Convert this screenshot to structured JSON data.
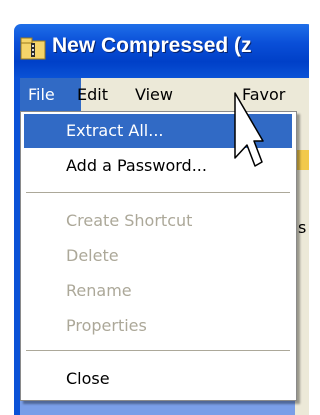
{
  "window": {
    "title": "New Compressed (z"
  },
  "menubar": {
    "items": [
      "File",
      "Edit",
      "View",
      "Favor"
    ]
  },
  "file_menu": {
    "extract_all": "Extract All...",
    "add_password": "Add a Password...",
    "create_shortcut": "Create Shortcut",
    "delete": "Delete",
    "rename": "Rename",
    "properties": "Properties",
    "close": "Close"
  },
  "background": {
    "partial_text": "s"
  },
  "colors": {
    "titlebar": "#0a4fd8",
    "highlight": "#316ac5",
    "menubar": "#ece9d8",
    "disabled": "#aca899"
  }
}
